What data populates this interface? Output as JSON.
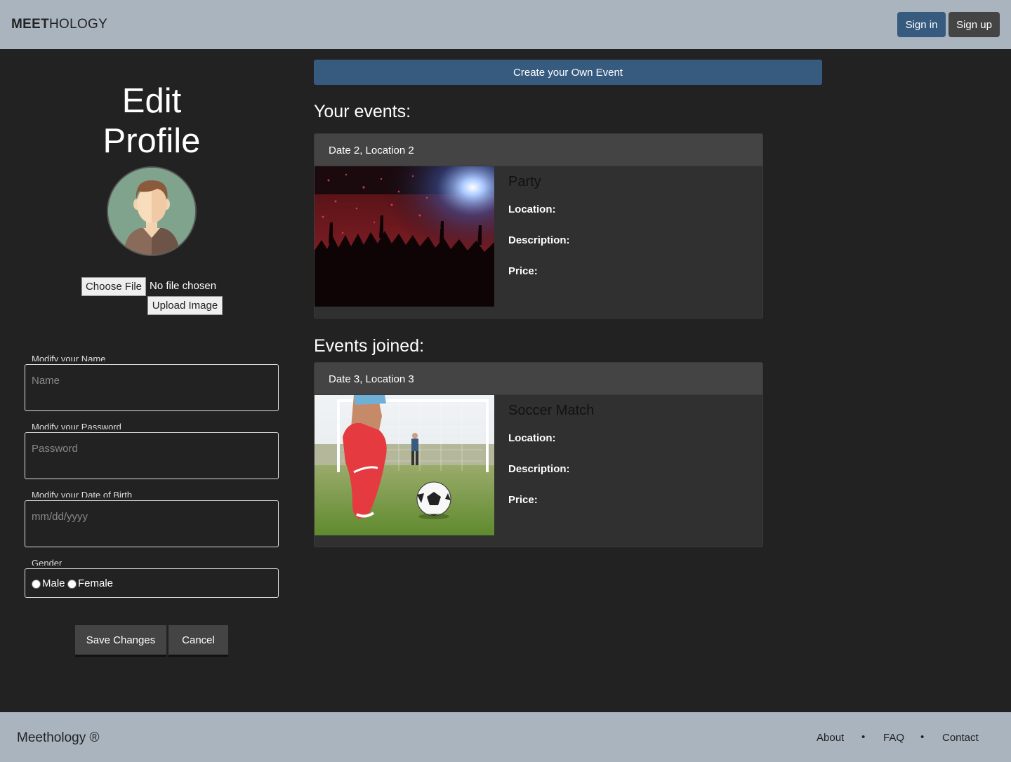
{
  "header": {
    "brand_bold": "MEET",
    "brand_rest": "HOLOGY",
    "signin_label": "Sign in",
    "signup_label": "Sign up"
  },
  "profile": {
    "title_line1": "Edit",
    "title_line2": "Profile",
    "choose_file_label": "Choose File",
    "no_file_text": "No file chosen",
    "upload_label": "Upload Image",
    "name_label": "Modify your Name",
    "name_placeholder": "Name",
    "password_label": "Modify your Password",
    "password_placeholder": "Password",
    "dob_label": "Modify your Date of Birth",
    "dob_placeholder": "mm/dd/yyyy",
    "gender_label": "Gender",
    "gender_options": [
      "Male",
      "Female"
    ],
    "save_label": "Save Changes",
    "cancel_label": "Cancel"
  },
  "events": {
    "create_label": "Create your Own Event",
    "your_events_heading": "Your events:",
    "joined_heading": "Events joined:",
    "location_label": "Location:",
    "description_label": "Description:",
    "price_label": "Price:",
    "your_events": [
      {
        "header": "Date 2, Location 2",
        "title": "Party",
        "image": "concert-crowd-photo"
      }
    ],
    "joined_events": [
      {
        "header": "Date 3, Location 3",
        "title": "Soccer Match",
        "image": "soccer-kick-photo"
      }
    ]
  },
  "footer": {
    "brand": "Meethology ®",
    "links": [
      "About",
      "FAQ",
      "Contact"
    ],
    "separator": "•"
  },
  "colors": {
    "bar": "#aab4be",
    "primary": "#375a7f",
    "dark_button": "#444444",
    "background": "#222222",
    "card": "#303030"
  }
}
